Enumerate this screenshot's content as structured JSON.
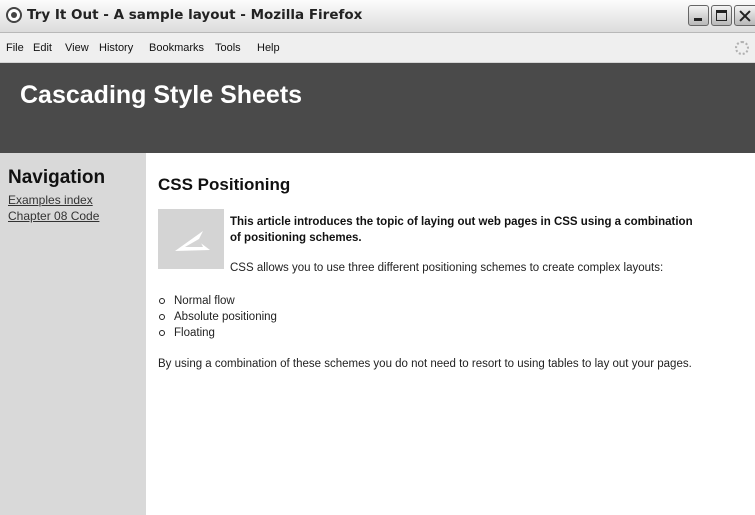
{
  "window": {
    "title": "Try It Out - A sample layout - Mozilla Firefox",
    "app_icon": "firefox-icon",
    "controls": [
      "minimize-icon",
      "maximize-icon",
      "close-icon"
    ]
  },
  "menubar": {
    "items": [
      {
        "label": "File"
      },
      {
        "label": "Edit"
      },
      {
        "label": "View"
      },
      {
        "label": "History"
      },
      {
        "label": "Bookmarks"
      },
      {
        "label": "Tools"
      },
      {
        "label": "Help"
      }
    ],
    "throbber_icon": "loading-throbber-icon"
  },
  "page": {
    "header": {
      "title": "Cascading Style Sheets"
    },
    "sidebar": {
      "heading": "Navigation",
      "links": [
        {
          "label": "Examples index"
        },
        {
          "label": "Chapter 08 Code"
        }
      ]
    },
    "main": {
      "heading": "CSS Positioning",
      "image_icon": "image-placeholder-icon",
      "intro": "This article introduces the topic of laying out web pages in CSS using a combination of positioning schemes.",
      "schemes_sentence": "CSS allows you to use three different positioning schemes to create complex layouts:",
      "list": [
        "Normal flow",
        "Absolute positioning",
        "Floating"
      ],
      "closing": "By using a combination of these schemes you do not need to resort to using tables to lay out your pages."
    }
  },
  "colors": {
    "header_bg": "#4a4a4a",
    "sidebar_bg": "#d9d9d9",
    "content_bg": "#ffffff"
  }
}
